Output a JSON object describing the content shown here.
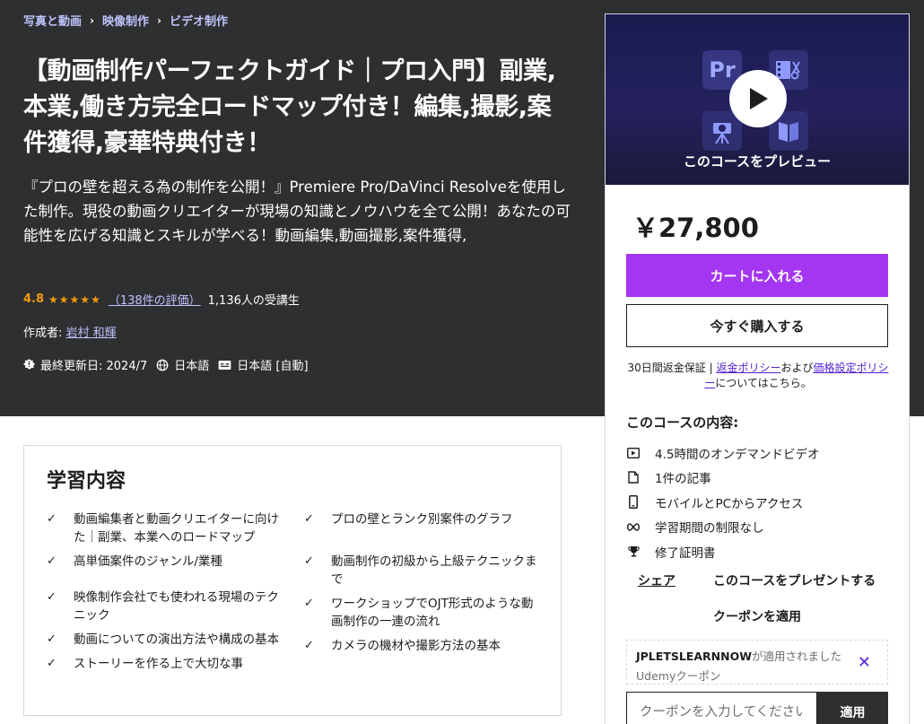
{
  "breadcrumb": [
    "写真と動画",
    "映像制作",
    "ビデオ制作"
  ],
  "breadcrumb_sep": "›",
  "course": {
    "title": "【動画制作パーフェクトガイド｜プロ入門】副業,本業,働き方完全ロードマップ付き！編集,撮影,案件獲得,豪華特典付き！",
    "subtitle": "『プロの壁を超える為の制作を公開！』Premiere Pro/DaVinci Resolveを使用した制作。現役の動画クリエイターが現場の知識とノウハウを全て公開！あなたの可能性を広げる知識とスキルが学べる！動画編集,動画撮影,案件獲得,",
    "rating": "4.8",
    "stars": "★★★★★",
    "rating_count": "（138件の評価）",
    "students": "1,136人の受講生",
    "author_label": "作成者:",
    "author_name": "岩村 和輝",
    "last_updated": "最終更新日: 2024/7",
    "language": "日本語",
    "captions": "日本語 [自動]"
  },
  "preview": {
    "label": "このコースをプレビュー",
    "pr_icon": "Pr"
  },
  "pricing": {
    "price": "￥27,800",
    "cart_button": "カートに入れる",
    "buy_button": "今すぐ購入する",
    "guarantee_text": "30日間返金保証 | ",
    "refund_link": "返金ポリシー",
    "and_text": "および",
    "pricing_link": "価格設定ポリシー",
    "guarantee_end": "についてはこちら。"
  },
  "includes": {
    "title": "このコースの内容:",
    "items": [
      {
        "icon": "video-icon",
        "text": "4.5時間のオンデマンドビデオ"
      },
      {
        "icon": "file-icon",
        "text": "1件の記事"
      },
      {
        "icon": "mobile-icon",
        "text": "モバイルとPCからアクセス"
      },
      {
        "icon": "infinity-icon",
        "text": "学習期間の制限なし"
      },
      {
        "icon": "trophy-icon",
        "text": "修了証明書"
      }
    ]
  },
  "actions": {
    "share": "シェア",
    "gift": "このコースをプレゼントする",
    "apply_coupon": "クーポンを適用"
  },
  "coupon": {
    "code": "JPLETSLEARNNOW",
    "applied_text": "が適用されました",
    "provider": "Udemyクーポン",
    "remove_symbol": "✕",
    "input_placeholder": "クーポンを入力してください",
    "apply_button": "適用"
  },
  "learn": {
    "title": "学習内容",
    "check_symbol": "✓",
    "left": [
      "動画編集者と動画クリエイターに向けた｜副業、本業へのロードマップ",
      "高単価案件のジャンル/業種",
      "映像制作会社でも使われる現場のテクニック",
      "動画についての演出方法や構成の基本",
      "ストーリーを作る上で大切な事"
    ],
    "right": [
      "プロの壁とランク別案件のグラフ",
      "動画制作の初級から上級テクニックまで",
      "ワークショップでOJT形式のような動画制作の一連の流れ",
      "カメラの機材や撮影方法の基本"
    ]
  },
  "colors": {
    "hero_bg": "#2d2f31",
    "accent_purple": "#a435f0",
    "link_purple": "#5624d0",
    "breadcrumb_lilac": "#c0c4fc",
    "star_orange": "#f69c08"
  }
}
